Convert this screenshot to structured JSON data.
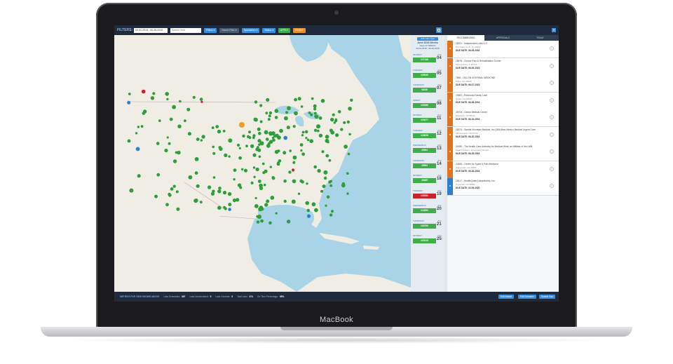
{
  "device": {
    "brand": "MacBook"
  },
  "toolbar": {
    "filters_label": "FILTERS:",
    "date_range": "06-03-2018 - 06-28-2018",
    "search_placeholder": "Search here",
    "buttons": [
      {
        "label": "Filters ▾",
        "style": "blue"
      },
      {
        "label": "Saved Filter ▾",
        "style": "gray"
      },
      {
        "label": "Specialties ▾",
        "style": "blue"
      },
      {
        "label": "Status ▾",
        "style": "blue"
      },
      {
        "label": "APPLY",
        "style": "green"
      },
      {
        "label": "RESET",
        "style": "orange"
      }
    ],
    "calendar_icon": "calendar-icon"
  },
  "map": {
    "water_color": "#a9d3e6",
    "land_color": "#efede4",
    "marker_colors": {
      "green": "#2e9e3a",
      "red": "#c8232c",
      "blue": "#2c7fc9",
      "orange": "#f29b2a"
    }
  },
  "schedule": {
    "add_button": "Add Labs Type",
    "title": "June 2018 Weeks",
    "subtitle": "Days 22 WEEKS",
    "range": "06-03-2018 - 06-28-2018",
    "days": [
      {
        "weekday": "MONDAY",
        "badge": "#17148",
        "month": "JUN",
        "day": "04",
        "status": "green"
      },
      {
        "weekday": "TUESDAY",
        "badge": "#20045",
        "month": "JUN",
        "day": "05",
        "status": "green"
      },
      {
        "weekday": "THURSDAY",
        "badge": "#8236",
        "month": "JUN",
        "day": "07",
        "status": "green"
      },
      {
        "weekday": "FRIDAY",
        "badge": "#25289",
        "month": "JUN",
        "day": "08",
        "status": "green"
      },
      {
        "weekday": "MONDAY",
        "badge": "#20477",
        "month": "JUN",
        "day": "11",
        "status": "green"
      },
      {
        "weekday": "TUESDAY",
        "badge": "#20818",
        "month": "JUN",
        "day": "12",
        "status": "green"
      },
      {
        "weekday": "WEDNESDAY",
        "badge": "#5994",
        "month": "JUN",
        "day": "13",
        "status": "green"
      },
      {
        "weekday": "THURSDAY",
        "badge": "#5993",
        "month": "JUN",
        "day": "14",
        "status": "green"
      },
      {
        "weekday": "MONDAY",
        "badge": "#9465",
        "month": "JUN",
        "day": "18",
        "status": "green"
      },
      {
        "weekday": "TUESDAY",
        "badge": "#28251",
        "month": "JUN",
        "day": "19",
        "status": "red"
      },
      {
        "weekday": "WEDNESDAY",
        "badge": "#14954",
        "month": "JUN",
        "day": "20",
        "status": "green"
      },
      {
        "weekday": "THURSDAY",
        "badge": "#16790",
        "month": "JUN",
        "day": "21",
        "status": "green"
      },
      {
        "weekday": "MONDAY",
        "badge": "#23415",
        "month": "JUN",
        "day": "25",
        "status": "green"
      }
    ]
  },
  "panel": {
    "close_label": "✕",
    "tabs": [
      "RECOMMENDED",
      "APPROVALS",
      "TODAY"
    ],
    "labs": [
      {
        "title": "28221 - Independent Labs LLC",
        "addr": "Port Saint Lucie, FL 34952",
        "due": "DUE DATE: 06-05-2018",
        "color": "#e0731f"
      },
      {
        "title": "26676 - Choice Pain & Rehabilitation Center",
        "addr": "Schaumburg, IL 60173",
        "due": "DUE DATE: 06-06-2018",
        "color": "#e0731f"
      },
      {
        "title": "7665 - DILLON INTERNAL MEDICINE",
        "addr": "Dillon, SC 29536",
        "due": "DUE DATE: 06-07-2018",
        "color": "#e0731f"
      },
      {
        "title": "20657 - Redmond Family Care",
        "addr": "Rome, GA 30165",
        "due": "DUE DATE: 06-08-2018",
        "color": "#e0731f"
      },
      {
        "title": "26704 - Ocean Medical Center",
        "addr": "Bricktown, NJ 08724",
        "due": "DUE DATE: 06-19-2018",
        "color": "#e0731f"
      },
      {
        "title": "28274 - Sandia Mountain Medical, Inc. DBA New Mexico Medical Urgent Care",
        "addr": "Albuquerque, NM 87111",
        "due": "DUE DATE: 06-20-2018",
        "color": "#e0731f"
      },
      {
        "title": "24050 - The Health Care Authority for Medical West, an Affiliate of the UAB",
        "addr": "Health System - Emergency Depart",
        "due": "DUE DATE: 06-25-2018",
        "color": "#e0731f"
      },
      {
        "title": "24050 - Center for Spine & Pain Medicine",
        "addr": "Gainesville, GA 30501",
        "due": "DUE DATE: 06-28-2018",
        "color": "#e0731f"
      },
      {
        "title": "29117 - HealthQuest Laboratories, Inc.",
        "addr": "Temecula, CA 92590",
        "due": "DUE DATE: 02-09-2020",
        "color": "#2c7fc9"
      }
    ]
  },
  "footer": {
    "title": "METRICS FOR VIEW SHOWN ABOVE",
    "metrics": [
      {
        "label": "Labs Scheduled:",
        "value": "387"
      },
      {
        "label": "Labs Unscheduled:",
        "value": "9"
      },
      {
        "label": "Labs Overdue:",
        "value": "9"
      },
      {
        "label": "Total Labs:",
        "value": "374"
      },
      {
        "label": "On Time Percentage:",
        "value": "95%"
      }
    ],
    "buttons": [
      "Edit Details",
      "Edit Schedule",
      "Submit Your"
    ]
  }
}
